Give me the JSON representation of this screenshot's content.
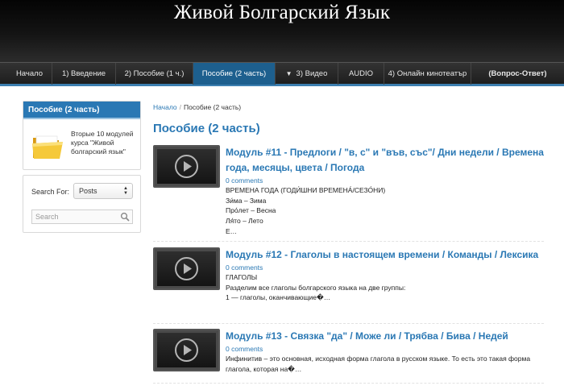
{
  "site": {
    "title": "Живой Болгарский Язык"
  },
  "nav": {
    "items": [
      {
        "label": "Начало"
      },
      {
        "label": "1) Введение"
      },
      {
        "label": "2) Пособие (1 ч.)"
      },
      {
        "label": "Пособие (2 часть)",
        "active": true
      },
      {
        "label": "3) Видео",
        "arrow": "▼"
      },
      {
        "label": "AUDIO"
      },
      {
        "label": "4) Онлайн кинотеатър"
      },
      {
        "label": "(Вопрос-Ответ)"
      }
    ]
  },
  "sidebar": {
    "promo": {
      "heading": "Пособие (2 часть)",
      "text": "Вторые 10 модулей курса \"Живой болгарский язык\"",
      "icon": "folder-icon"
    },
    "search": {
      "label": "Search For:",
      "select_value": "Posts",
      "placeholder": "Search",
      "icon": "search-icon"
    }
  },
  "breadcrumb": {
    "home": "Начало",
    "separator": "/",
    "current": "Пособие (2 часть)"
  },
  "page": {
    "title": "Пособие (2 часть)"
  },
  "posts": [
    {
      "title": "Модуль #11 - Предлоги / \"в, с\" и \"във, със\"/ Дни недели / Времена года, месяцы, цвета / Погода",
      "comments": "0 comments",
      "lines": [
        "ВРЕМЕНА ГОДА (ГОДИ́ШНИ ВРЕМЕНА́/СЕЗО́НИ)",
        "Зи́ма – Зима",
        "Про́лет – Весна",
        "Ля́то – Лето",
        "Е…"
      ]
    },
    {
      "title": "Модуль #12 - Глаголы в настоящем времени / Команды / Лексика",
      "comments": "0 comments",
      "lines": [
        "ГЛАГОЛЫ",
        "Разделим все глаголы болгарского языка на две группы:",
        "1 — глаголы, оканчивающие�…"
      ]
    },
    {
      "title": "Модуль #13 - Связка \"да\" / Може ли / Трябва / Бива / Недей",
      "comments": "0 comments",
      "lines": [
        "Инфинитив – это основная, исходная форма глагола в русском языке. То есть это такая форма глагола, которая на�…"
      ]
    }
  ],
  "colors": {
    "accent": "#2a78b4",
    "nav_active": "#1d5f8e",
    "header_bg": "#0a0a0a"
  }
}
